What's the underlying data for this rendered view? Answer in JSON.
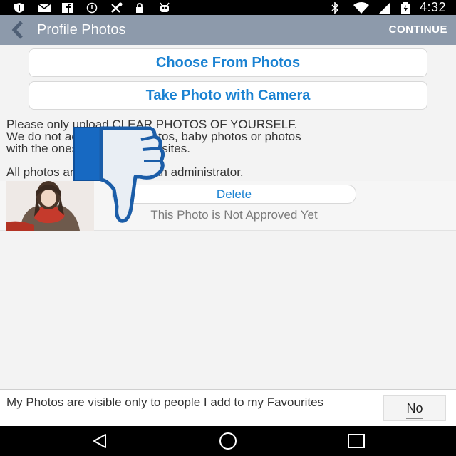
{
  "status_bar": {
    "time": "4:32",
    "left_icons": [
      "shield-icon",
      "mail-icon",
      "facebook-icon",
      "sync-disabled-icon",
      "tools-icon",
      "lock-icon",
      "android-icon"
    ],
    "right_icons": [
      "bluetooth-icon",
      "wifi-icon",
      "signal-icon",
      "battery-icon"
    ]
  },
  "app_bar": {
    "title": "Profile Photos",
    "continue_label": "CONTINUE",
    "background": "#8d9aab"
  },
  "actions": {
    "choose_label": "Choose From Photos",
    "camera_label": "Take Photo with Camera",
    "accent": "#1a82d2"
  },
  "notice": {
    "line1": "Please only upload CLEAR PHOTOS OF YOURSELF.",
    "line2": "We do not accept group photos, baby photos or photos",
    "line3": "with the ones from other websites.",
    "approval": "All photos are approved by an administrator."
  },
  "photo": {
    "delete_label": "Delete",
    "status_text": "This Photo is Not Approved Yet",
    "overlay_icon": "thumbs-down-icon"
  },
  "visibility": {
    "text": "My Photos are visible only to people I add to my Favourites",
    "toggle_value": "No"
  },
  "nav": {
    "icons": [
      "back-triangle-icon",
      "home-circle-icon",
      "recents-square-icon"
    ]
  }
}
